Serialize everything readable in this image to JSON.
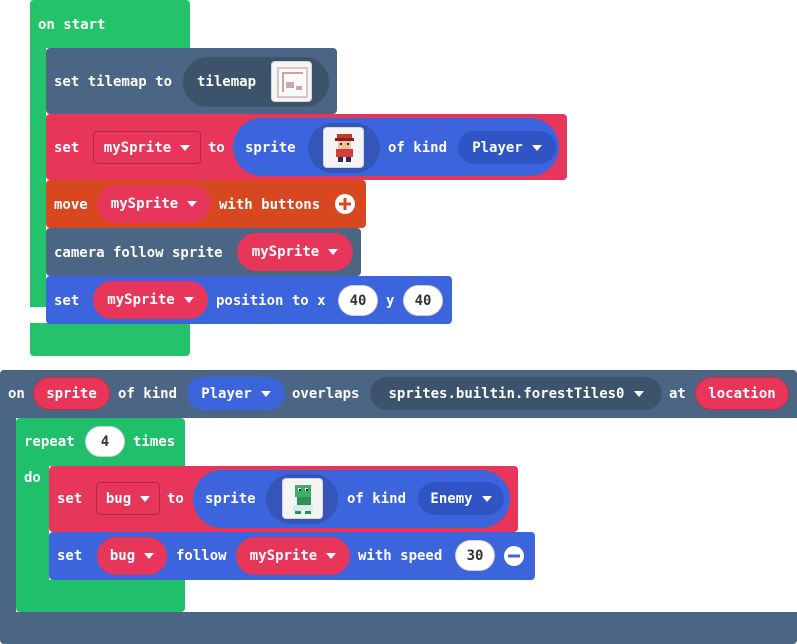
{
  "colors": {
    "events": "#23c26b",
    "scene": "#4b6584",
    "sprites": "#e8365a",
    "sprite_pill": "#3c64dc",
    "controller": "#d74821",
    "loops": "#20bf6b",
    "white": "#ffffff"
  },
  "on_start": {
    "label": "on start",
    "set_tilemap": {
      "set": "set tilemap to",
      "tilemap": "tilemap"
    },
    "set_sprite": {
      "set": "set",
      "var": "mySprite",
      "to": "to",
      "sprite": "sprite",
      "of_kind": "of kind",
      "kind": "Player",
      "icon": "player-sprite-image"
    },
    "move": {
      "move": "move",
      "var": "mySprite",
      "with_buttons": "with buttons",
      "icon": "add-icon"
    },
    "camera": {
      "label": "camera follow sprite",
      "var": "mySprite"
    },
    "position": {
      "set": "set",
      "var": "mySprite",
      "position_to": "position to x",
      "x": "40",
      "y_label": "y",
      "y": "40"
    }
  },
  "overlap_event": {
    "on": "on",
    "sprite": "sprite",
    "of_kind": "of kind",
    "kind": "Player",
    "overlaps": "overlaps",
    "tile": "sprites.builtin.forestTiles0",
    "at": "at",
    "location": "location",
    "repeat": {
      "repeat": "repeat",
      "count": "4",
      "times": "times",
      "do": "do"
    },
    "set_bug": {
      "set": "set",
      "var": "bug",
      "to": "to",
      "sprite": "sprite",
      "of_kind": "of kind",
      "kind": "Enemy",
      "icon": "enemy-sprite-image"
    },
    "follow": {
      "set": "set",
      "var": "bug",
      "follow": "follow",
      "target": "mySprite",
      "with_speed": "with speed",
      "speed": "30",
      "icon": "remove-icon"
    }
  }
}
